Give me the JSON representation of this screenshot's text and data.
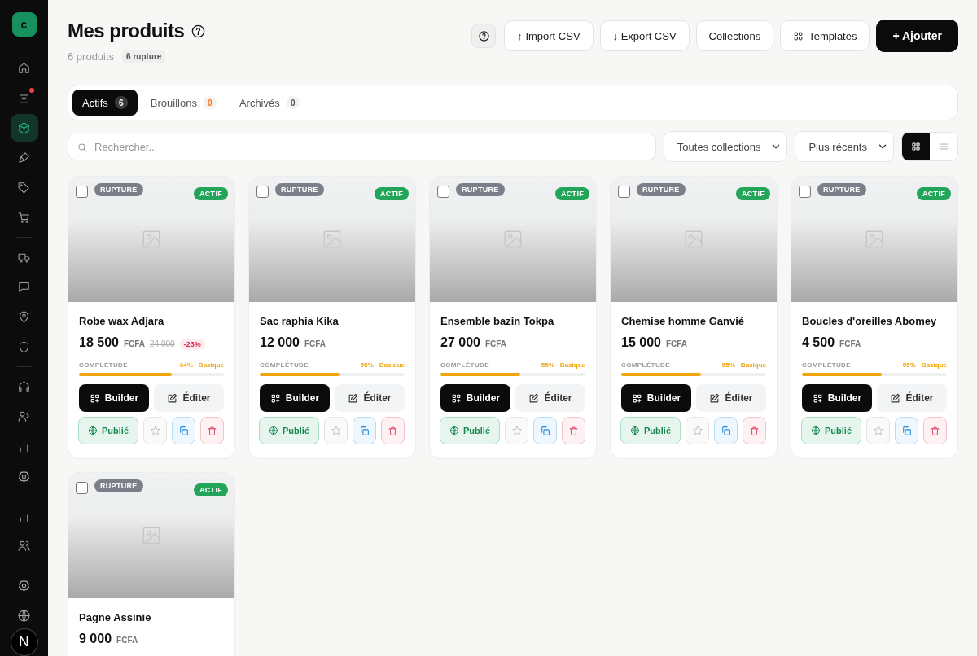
{
  "sidebar": {
    "logo": "c",
    "items": [
      {
        "selected": false,
        "notification": false
      },
      {
        "selected": false,
        "notification": true
      },
      {
        "selected": true,
        "notification": false
      },
      {
        "selected": false,
        "notification": false
      },
      {
        "selected": false,
        "notification": false
      },
      {
        "selected": false,
        "notification": false
      },
      {
        "selected": false,
        "notification": false
      },
      {
        "selected": false,
        "notification": false
      },
      {
        "selected": false,
        "notification": false
      },
      {
        "selected": false,
        "notification": false
      },
      {
        "selected": false,
        "notification": false
      },
      {
        "selected": false,
        "notification": false
      },
      {
        "selected": false,
        "notification": false
      },
      {
        "selected": false,
        "notification": false
      },
      {
        "selected": false,
        "notification": false
      },
      {
        "selected": false,
        "notification": false
      },
      {
        "selected": false,
        "notification": false
      },
      {
        "selected": false,
        "notification": false
      }
    ],
    "avatar": "N"
  },
  "header": {
    "title": "Mes produits",
    "count": "6 produits",
    "stock_badge": "6 rupture",
    "buttons": [
      {
        "label": "↑ Import CSV",
        "kind": "outline"
      },
      {
        "label": "↓ Export CSV",
        "kind": "outline"
      },
      {
        "label": "Collections",
        "kind": "outline"
      },
      {
        "label": "Templates",
        "kind": "templates"
      },
      {
        "label": "+ Ajouter",
        "kind": "primary"
      }
    ]
  },
  "tabs": [
    {
      "label": "Actifs",
      "count": "6",
      "selected": true,
      "kind": "default"
    },
    {
      "label": "Brouillons",
      "count": "0",
      "selected": false,
      "kind": "draft"
    },
    {
      "label": "Archivés",
      "count": "0",
      "selected": false,
      "kind": "default"
    }
  ],
  "filters": {
    "search": {
      "placeholder": "Rechercher..."
    },
    "collection": "Toutes collections",
    "sort": "Plus récents",
    "views": [
      {
        "selected": true
      },
      {
        "selected": false
      }
    ]
  },
  "products": [
    {
      "name": "Robe wax Adjara",
      "price": "18 500",
      "currency": "FCFA",
      "old_price": "24 000",
      "discount": "-23%",
      "stock": "RUPTURE",
      "status": "ACTIF",
      "checked": false,
      "completeness_label": "COMPLÉTUDE",
      "completeness": "64% · Basique",
      "level": 0.64,
      "builder": "Builder",
      "edit": "Éditer",
      "published": "Publié"
    },
    {
      "name": "Sac raphia Kika",
      "price": "12 000",
      "currency": "FCFA",
      "stock": "RUPTURE",
      "status": "ACTIF",
      "checked": false,
      "completeness_label": "COMPLÉTUDE",
      "completeness": "55% · Basique",
      "level": 0.55,
      "builder": "Builder",
      "edit": "Éditer",
      "published": "Publié"
    },
    {
      "name": "Ensemble bazin Tokpa",
      "price": "27 000",
      "currency": "FCFA",
      "stock": "RUPTURE",
      "status": "ACTIF",
      "checked": false,
      "completeness_label": "COMPLÉTUDE",
      "completeness": "55% · Basique",
      "level": 0.55,
      "builder": "Builder",
      "edit": "Éditer",
      "published": "Publié"
    },
    {
      "name": "Chemise homme Ganvié",
      "price": "15 000",
      "currency": "FCFA",
      "stock": "RUPTURE",
      "status": "ACTIF",
      "checked": false,
      "completeness_label": "COMPLÉTUDE",
      "completeness": "55% · Basique",
      "level": 0.55,
      "builder": "Builder",
      "edit": "Éditer",
      "published": "Publié"
    },
    {
      "name": "Boucles d'oreilles Abomey",
      "price": "4 500",
      "currency": "FCFA",
      "stock": "RUPTURE",
      "status": "ACTIF",
      "checked": false,
      "completeness_label": "COMPLÉTUDE",
      "completeness": "55% · Basique",
      "level": 0.55,
      "builder": "Builder",
      "edit": "Éditer",
      "published": "Publié"
    },
    {
      "name": "Pagne Assinie",
      "price": "9 000",
      "currency": "FCFA",
      "stock": "RUPTURE",
      "status": "ACTIF",
      "checked": false
    }
  ]
}
